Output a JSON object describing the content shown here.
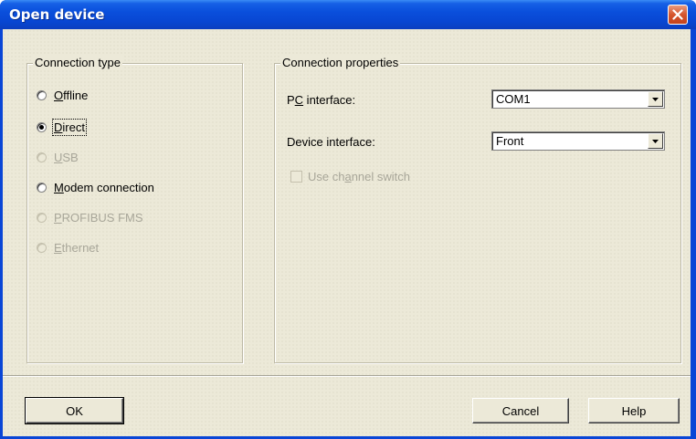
{
  "window": {
    "title": "Open device",
    "close_icon": "close-icon"
  },
  "connection_type": {
    "legend": "Connection type",
    "options": [
      {
        "pre": "",
        "key": "O",
        "post": "ffline",
        "checked": false,
        "enabled": true
      },
      {
        "pre": "",
        "key": "D",
        "post": "irect",
        "checked": true,
        "enabled": true
      },
      {
        "pre": "",
        "key": "U",
        "post": "SB",
        "checked": false,
        "enabled": false
      },
      {
        "pre": "",
        "key": "M",
        "post": "odem connection",
        "checked": false,
        "enabled": true
      },
      {
        "pre": "",
        "key": "P",
        "post": "ROFIBUS FMS",
        "checked": false,
        "enabled": false
      },
      {
        "pre": "",
        "key": "E",
        "post": "thernet",
        "checked": false,
        "enabled": false
      }
    ]
  },
  "connection_properties": {
    "legend": "Connection properties",
    "pc_interface": {
      "pre": "P",
      "key": "C",
      "post": " interface:",
      "value": "COM1"
    },
    "device_interface": {
      "label": "Device interface:",
      "value": "Front"
    },
    "channel_switch": {
      "pre": "Use ch",
      "key": "a",
      "post": "nnel switch",
      "checked": false,
      "enabled": false
    }
  },
  "buttons": {
    "ok": "OK",
    "cancel": "Cancel",
    "help": "Help"
  }
}
